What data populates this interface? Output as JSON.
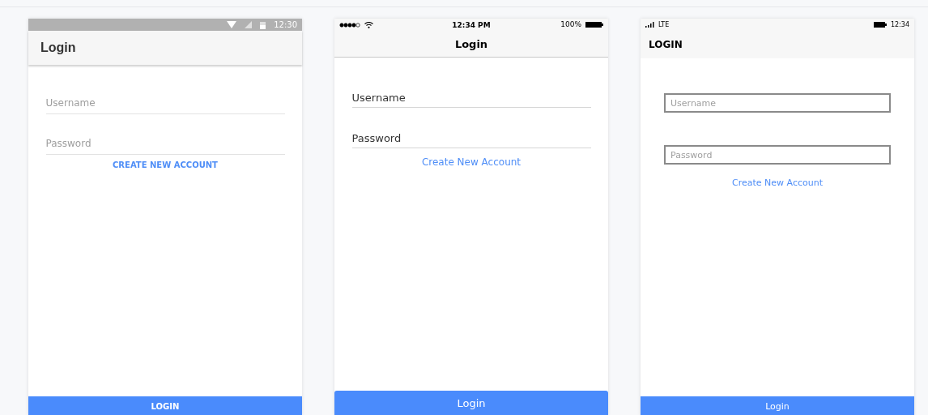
{
  "phones": [
    {
      "kind": "android",
      "status_bar": {
        "time": "12:30"
      },
      "title": "Login",
      "fields": [
        {
          "placeholder": "Username"
        },
        {
          "placeholder": "Password"
        }
      ],
      "link": "CREATE NEW ACCOUNT",
      "button": "LOGIN"
    },
    {
      "kind": "ios",
      "status_bar": {
        "time": "12:34 PM",
        "battery": "100%"
      },
      "title": "Login",
      "fields": [
        {
          "placeholder": "Username"
        },
        {
          "placeholder": "Password"
        }
      ],
      "link": "Create New Account",
      "button": "Login"
    },
    {
      "kind": "windows",
      "status_bar": {
        "network": "LTE",
        "time": "12:34"
      },
      "title": "LOGIN",
      "fields": [
        {
          "placeholder": "Username"
        },
        {
          "placeholder": "Password"
        }
      ],
      "link": "Create New Account",
      "button": "Login"
    }
  ]
}
